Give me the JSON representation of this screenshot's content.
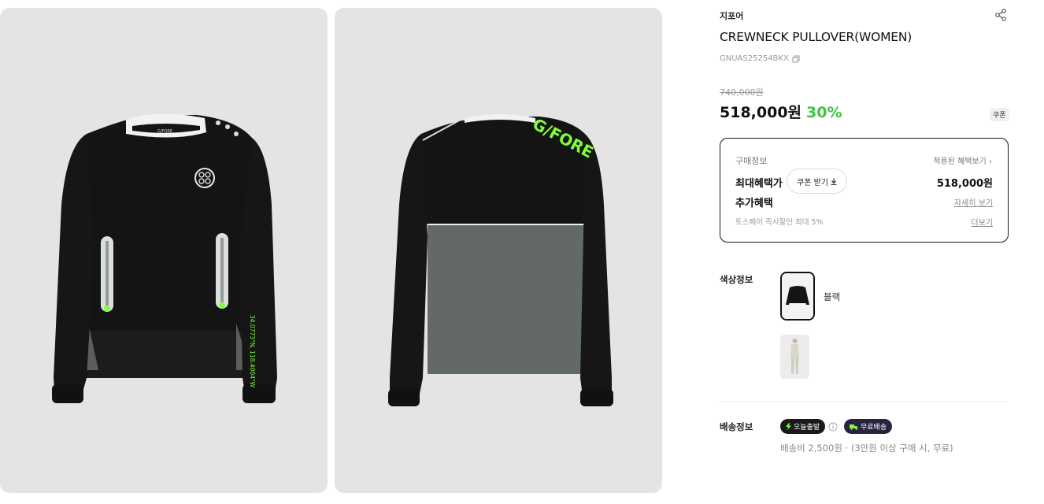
{
  "brand": "지포어",
  "product": {
    "title": "CREWNECK PULLOVER(WOMEN)",
    "sku": "GNUAS25254BKX",
    "original_price": "740,000원",
    "sale_price": "518,000원",
    "discount": "30%",
    "coupon_tag": "쿠폰"
  },
  "benefit": {
    "label": "구매정보",
    "applied_link": "적용된 혜택보기 ›",
    "max_label": "최대혜택가",
    "coupon_button": "쿠폰 받기",
    "coupon_button_icon": "download-icon",
    "max_price": "518,000원",
    "extra_label": "추가혜택",
    "detail_link": "자세히 보기",
    "toss_text": "토스페이 즉시할인 최대 5%",
    "more_link": "더보기"
  },
  "color": {
    "label": "색상정보",
    "options": [
      {
        "name": "블랙",
        "selected": true
      },
      {
        "name": "",
        "selected": false
      }
    ]
  },
  "shipping": {
    "label": "배송정보",
    "today_badge": "오늘출발",
    "free_badge": "무료배송",
    "fee_text": "배송비 2,500원 · (3만원 이상 구매 시, 무료)"
  },
  "images": {
    "front_logo_text": "G/FORE",
    "back_print": "G/FORE",
    "sleeve_print": "34.0773°N, 118.4004°W"
  },
  "colors": {
    "accent_green": "#3ec43e",
    "neon": "#7dff3a",
    "panel_bg": "#e4e4e4"
  }
}
